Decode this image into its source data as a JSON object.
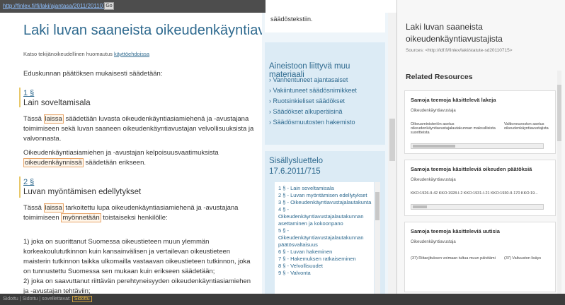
{
  "urlbar": {
    "url": "http://finlex.fi/fi/laki/ajantasa/2011/20110715",
    "button": "Go"
  },
  "main": {
    "title": "Laki luvan saaneista oikeudenkäyntiavustajista",
    "note_prefix": "Katso tekijänoikeudellinen huomautus",
    "note_link": "käyttöehdoissa",
    "intro": "Eduskunnan päätöksen mukaisesti säädetään:",
    "sections": [
      {
        "num": "1 §",
        "title": "Lain soveltamisala",
        "p1_pre": "Tässä",
        "p1_hl": "laissa",
        "p1_post": "säädetään luvasta oikeudenkäyntiasiamiehenä ja -avustajana toimimiseen sekä luvan saaneen oikeudenkäyntiavustajan velvollisuuksista ja valvonnasta.",
        "p2_pre": "Oikeudenkäyntiasiamiehen ja -avustajan kelpoisuusvaatimuksista",
        "p2_hl": "oikeudenkäynnissä",
        "p2_post": "säädetään erikseen."
      },
      {
        "num": "2 §",
        "title": "Luvan myöntämisen edellytykset",
        "p1_pre": "Tässä",
        "p1_hl": "laissa",
        "p1_mid": "tarkoitettu lupa oikeudenkäyntiasiamiehenä ja -avustajana toimimiseen",
        "p1_hl2": "myönnetään",
        "p1_post": "toistaiseksi henkilölle:",
        "item1": "1) joka on suorittanut Suomessa oikeustieteen muun ylemmän korkeakoulututkinnon kuin kansainvälisen ja vertailevan oikeustieteen maisterin tutkinnon taikka ulkomailla vastaavan oikeustieteen tutkinnon, joka on tunnustettu Suomessa sen mukaan kuin erikseen säädetään;",
        "item2": "2) joka on saavuttanut riittävän perehtyneisyyden oikeudenkäyntiasiamiehen ja -avustajan tehtäviin;"
      }
    ]
  },
  "midcol": {
    "top_text": "säädöstekstiin.",
    "materials_title": "Aineistoon liittyvä muu materiaali",
    "materials": [
      "› Vanhentuneet ajantasaiset",
      "› Vakiintuneet säädösnimikkeet",
      "› Ruotsinkieliset säädökset",
      "› Säädökset alkuperäisinä",
      "› Säädösmuutosten hakemisto"
    ],
    "toc_title": "Sisällysluettelo",
    "toc_date": "17.6.2011/715",
    "toc": [
      "1 § - Lain soveltamisala",
      "2 § - Luvan myöntämisen edellytykset",
      "3 § - Oikeudenkäyntiavustajalautakunta",
      "4 § - Oikeudenkäyntiavustajalautakunnan asettaminen ja kokoonpano",
      "5 § - Oikeudenkäyntiavustajalautakunnan päätösvaltaisuus",
      "6 § - Luvan hakeminen",
      "7 § - Hakemuksen ratkaiseminen",
      "8 § - Velvollisuudet",
      "9 § - Valvonta"
    ]
  },
  "rpanel": {
    "title": "Laki luvan saaneista oikeudenkäyntiavustajista",
    "sources": "Sources: <http://ldf.fi/finlex/laki/statute-sd20110715>",
    "related": "Related Resources",
    "cards": [
      {
        "title": "Samoja teemoja käsittelevä lakeja",
        "sub": "Oikeudenkäyntiavustaja",
        "row1a": "Oikeusministeriön asetus oikeudenkäyntiavustajalautakunnan maksullisista suoritteista",
        "row1b": "Valtioneuvoston asetus oikeudenkäyntiavustajista"
      },
      {
        "title": "Samoja teemoja käsitteleviä oikeuden päätöksiä",
        "sub": "Oikeudenkäyntiavustaja",
        "row1a": "KKO:1926-II-42  KKO:1928-I-2  KKO:1931-I-21  KKO:1930-II-170  KKO:19..."
      },
      {
        "title": "Samoja teemoja käsitteleviä uutisia",
        "sub": "Oikeudenkäyntiavustaja",
        "row1a": "(37) Riitaojituksen voimaan tultua muun päivitämisellä",
        "row1b": "(37) Valtuuston lisäys"
      }
    ]
  },
  "status": {
    "prefix": "Sidottu | Sidottu | sovellettavat:",
    "badge": "Sidottu"
  }
}
